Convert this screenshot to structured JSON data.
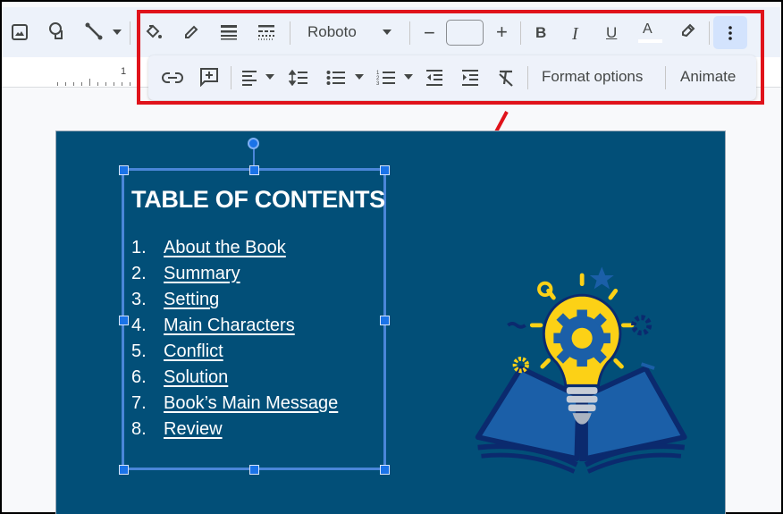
{
  "toolbar": {
    "left_icons": [
      {
        "name": "insert-image-icon"
      },
      {
        "name": "shape-icon"
      },
      {
        "name": "line-icon"
      }
    ],
    "row1": {
      "fill_color": "Fill color",
      "border_color": "Border color",
      "border_weight": "Border weight",
      "border_dash": "Border dash",
      "font": "Roboto",
      "decrease_size": "−",
      "font_size": "",
      "increase_size": "+",
      "bold": "B",
      "italic": "I",
      "underline": "U",
      "text_color": "A",
      "highlight": "Highlight color",
      "more": "More"
    },
    "row2": {
      "link": "Insert link",
      "comment": "Add comment",
      "align": "Align",
      "line_spacing": "Line spacing",
      "bulleted_list": "Bulleted list",
      "numbered_list": "Numbered list",
      "decrease_indent": "Decrease indent",
      "increase_indent": "Increase indent",
      "clear_formatting": "Clear formatting",
      "format_options": "Format options",
      "animate": "Animate"
    }
  },
  "ruler": {
    "label": "1"
  },
  "slide": {
    "title": "TABLE OF CONTENTS",
    "items": [
      {
        "num": "1.",
        "label": "About the Book"
      },
      {
        "num": "2.",
        "label": "Summary"
      },
      {
        "num": "3.",
        "label": "Setting"
      },
      {
        "num": "4.",
        "label": "Main Characters"
      },
      {
        "num": "5.",
        "label": "Conflict"
      },
      {
        "num": "6.",
        "label": "Solution"
      },
      {
        "num": "7.",
        "label": "Book’s Main Message"
      },
      {
        "num": "8.",
        "label": "Review"
      }
    ],
    "background": "#024f78",
    "illustration": "lightbulb-book-illustration"
  },
  "annotation": {
    "highlight_color": "#e0131b"
  }
}
